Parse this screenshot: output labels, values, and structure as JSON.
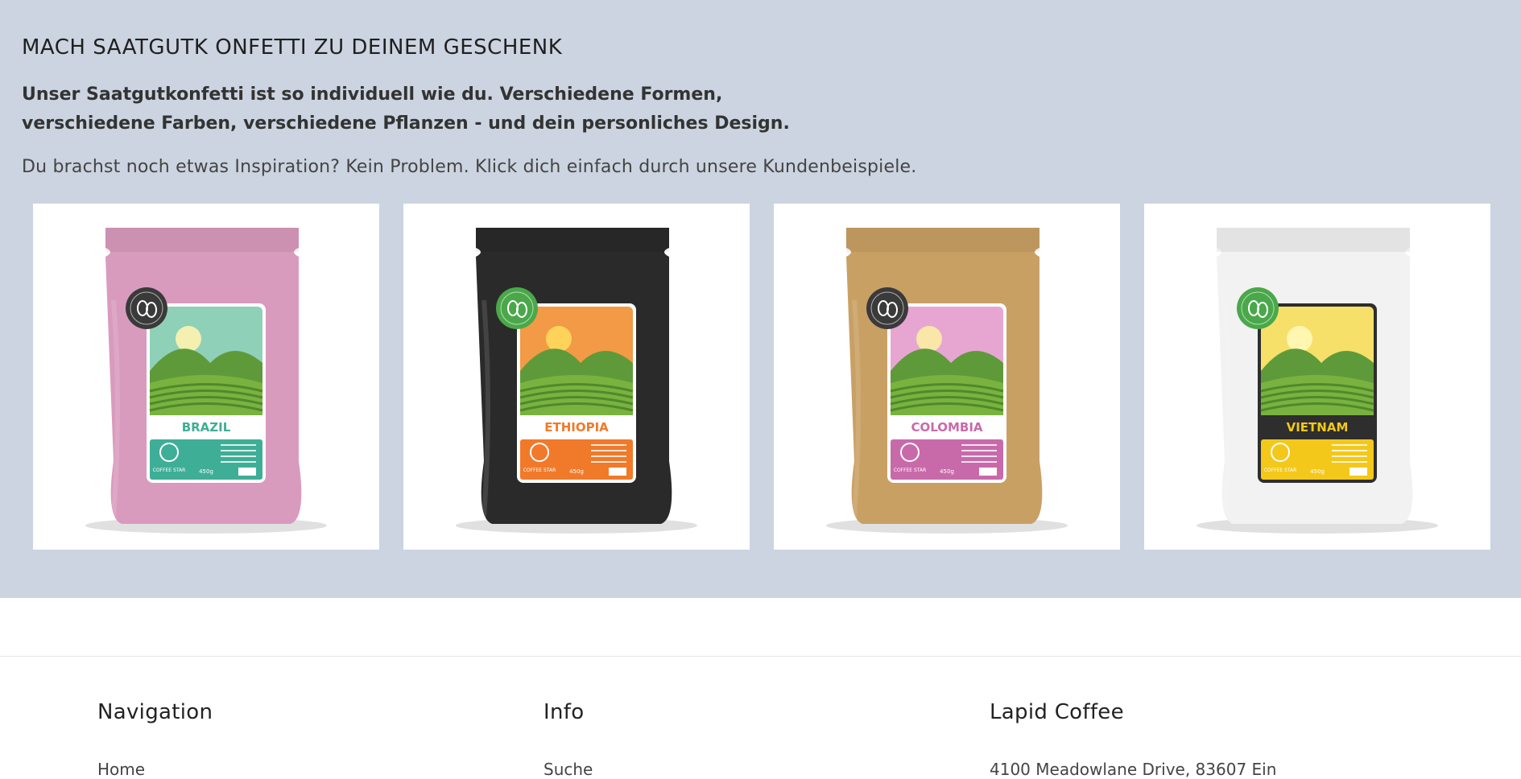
{
  "hero": {
    "title": "MACH SAATGUTK ONFETTI ZU DEINEM GESCHENK",
    "lead_line1": "Unser Saatgutkonfetti ist so individuell wie du. Verschiedene Formen,",
    "lead_line2": "verschiedene Farben, verschiedene Pflanzen - und dein personliches Design.",
    "sub": "Du brachst noch etwas Inspiration? Kein Problem. Klick dich einfach durch unsere Kundenbeispiele."
  },
  "products": [
    {
      "name": "BRAZIL",
      "bag_color": "#d99bbd",
      "label_color": "#3fae96",
      "weight": "450g",
      "badge_color": "#3a3a3a",
      "brand": "COFFEE STAR"
    },
    {
      "name": "ETHIOPIA",
      "bag_color": "#2a2a2a",
      "label_color": "#f07a2a",
      "weight": "450g",
      "badge_color": "#4aa84a",
      "brand": "COFFEE STAR"
    },
    {
      "name": "COLOMBIA",
      "bag_color": "#c9a064",
      "label_color": "#c86aaa",
      "weight": "450g",
      "badge_color": "#3a3a3a",
      "brand": "COFFEE STAR"
    },
    {
      "name": "VIETNAM",
      "bag_color": "#f2f2f2",
      "label_color": "#f3c81a",
      "weight": "450g",
      "badge_color": "#4aa84a",
      "brand": "COFFEE STAR"
    }
  ],
  "footer": {
    "navigation": {
      "title": "Navigation",
      "first_link": "Home"
    },
    "info": {
      "title": "Info",
      "first_link": "Suche"
    },
    "company": {
      "title": "Lapid Coffee",
      "address": "4100 Meadowlane Drive, 83607 Ein"
    }
  }
}
